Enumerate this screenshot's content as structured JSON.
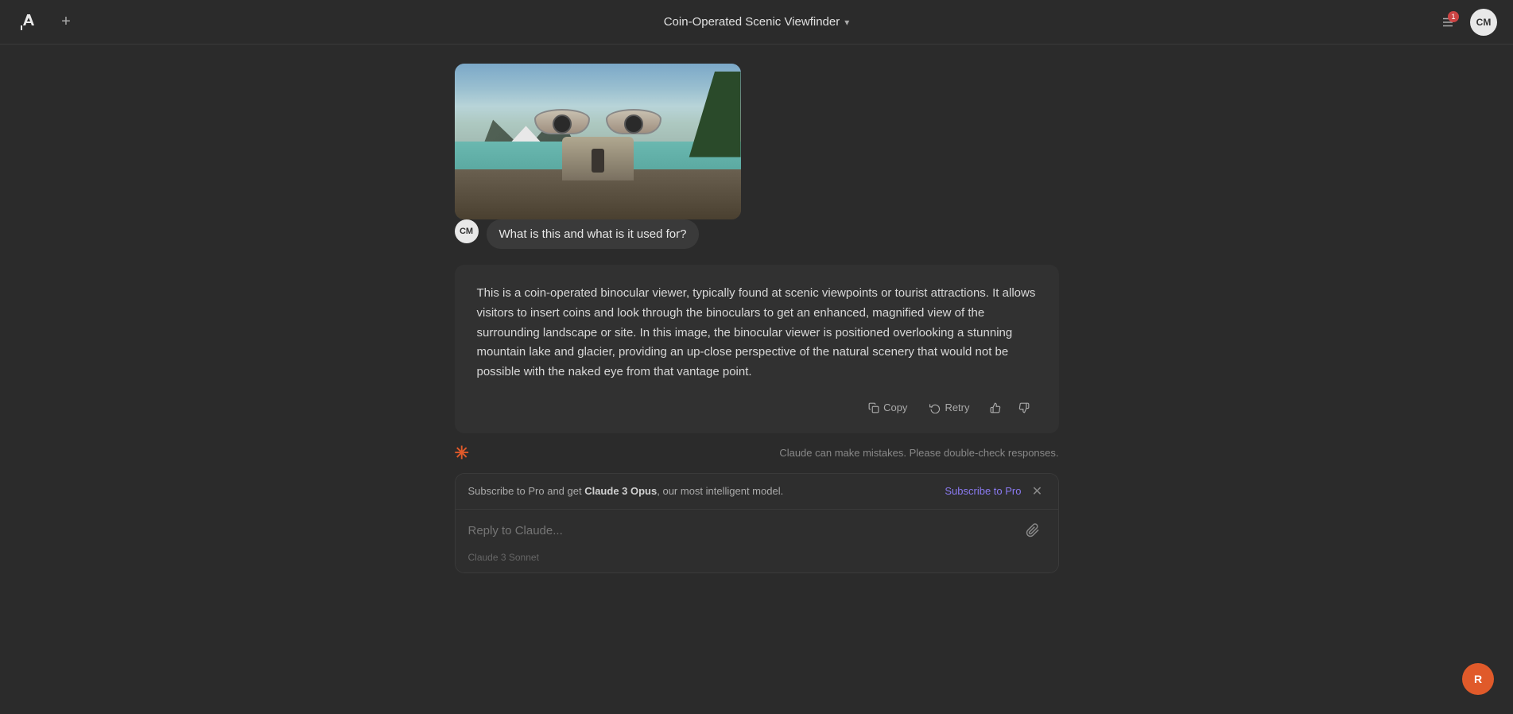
{
  "topbar": {
    "logo": "A",
    "new_chat_label": "+",
    "title": "Coin-Operated Scenic Viewfinder",
    "chevron": "▾",
    "settings_label": "⚙",
    "notification_count": "1",
    "avatar_label": "CM"
  },
  "user_message": {
    "avatar": "CM",
    "text": "What is this and what is it used for?"
  },
  "assistant": {
    "response": "This is a coin-operated binocular viewer, typically found at scenic viewpoints or tourist attractions. It allows visitors to insert coins and look through the binoculars to get an enhanced, magnified view of the surrounding landscape or site. In this image, the binocular viewer is positioned overlooking a stunning mountain lake and glacier, providing an up-close perspective of the natural scenery that would not be possible with the naked eye from that vantage point.",
    "copy_label": "Copy",
    "retry_label": "Retry",
    "disclaimer": "Claude can make mistakes. Please double-check responses."
  },
  "subscribe_banner": {
    "text_before": "Subscribe to Pro and get ",
    "model_name": "Claude 3 Opus",
    "text_after": ", our most intelligent model.",
    "cta": "Subscribe to Pro"
  },
  "input": {
    "placeholder": "Reply to Claude...",
    "model": "Claude 3 Sonnet"
  },
  "bottom_avatar": "R"
}
